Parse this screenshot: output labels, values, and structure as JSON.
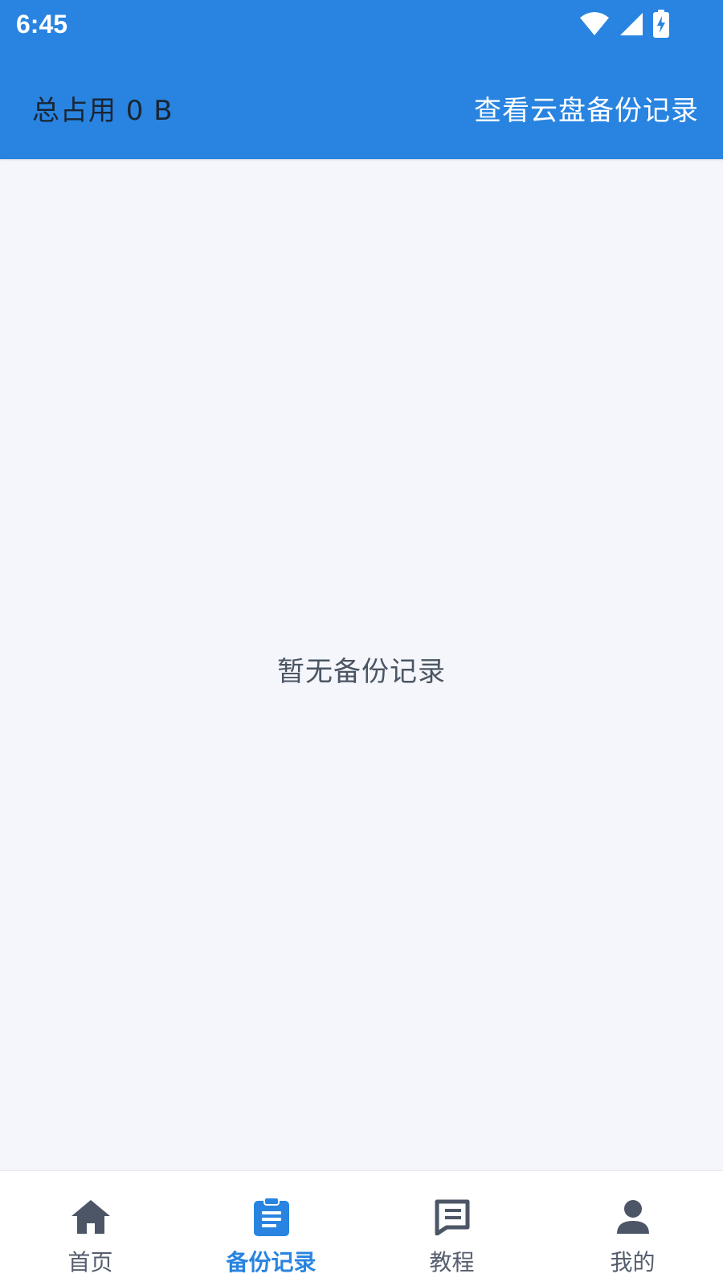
{
  "status_bar": {
    "time": "6:45",
    "icons": [
      "wifi-icon",
      "cellular-signal-icon",
      "battery-charging-icon"
    ]
  },
  "header": {
    "storage_label": "总占用 0 B",
    "cloud_link_label": "查看云盘备份记录"
  },
  "main": {
    "empty_message": "暂无备份记录"
  },
  "bottom_nav": {
    "items": [
      {
        "label": "首页",
        "icon": "home-icon",
        "active": false
      },
      {
        "label": "备份记录",
        "icon": "clipboard-icon",
        "active": true
      },
      {
        "label": "教程",
        "icon": "document-icon",
        "active": false
      },
      {
        "label": "我的",
        "icon": "person-icon",
        "active": false
      }
    ]
  },
  "colors": {
    "primary": "#2884e0",
    "background": "#f4f6fb",
    "nav_inactive": "#555e6e",
    "header_dark_text": "#1a2533"
  }
}
